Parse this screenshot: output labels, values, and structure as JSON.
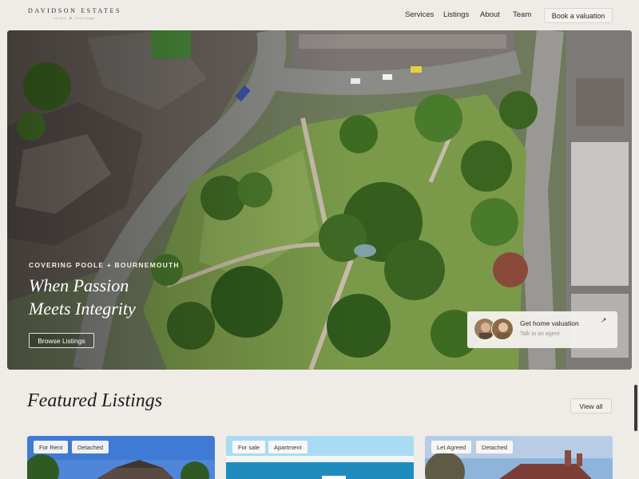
{
  "brand": {
    "name": "DAVIDSON ESTATES",
    "tagline": "sales & lettings"
  },
  "nav": {
    "links": [
      "Services",
      "Listings",
      "About",
      "Team"
    ],
    "cta": "Book a valuation"
  },
  "hero": {
    "eyebrow": "COVERING POOLE + BOURNEMOUTH",
    "title_line1": "When Passion",
    "title_line2": "Meets Integrity",
    "button": "Browse Listings",
    "valuation_card": {
      "title": "Get home valuation",
      "subtitle": "Talk to an agent",
      "arrow": "↗"
    }
  },
  "featured": {
    "title": "Featured Listings",
    "view_all": "View all",
    "cards": [
      {
        "badges": [
          "For Rent",
          "Detached"
        ]
      },
      {
        "badges": [
          "For sale",
          "Apartment"
        ]
      },
      {
        "badges": [
          "Let Agreed",
          "Detached"
        ]
      }
    ]
  },
  "colors": {
    "background": "#efebe7",
    "park_green": "#5f8a3e",
    "road_gray": "#8b8b88"
  }
}
